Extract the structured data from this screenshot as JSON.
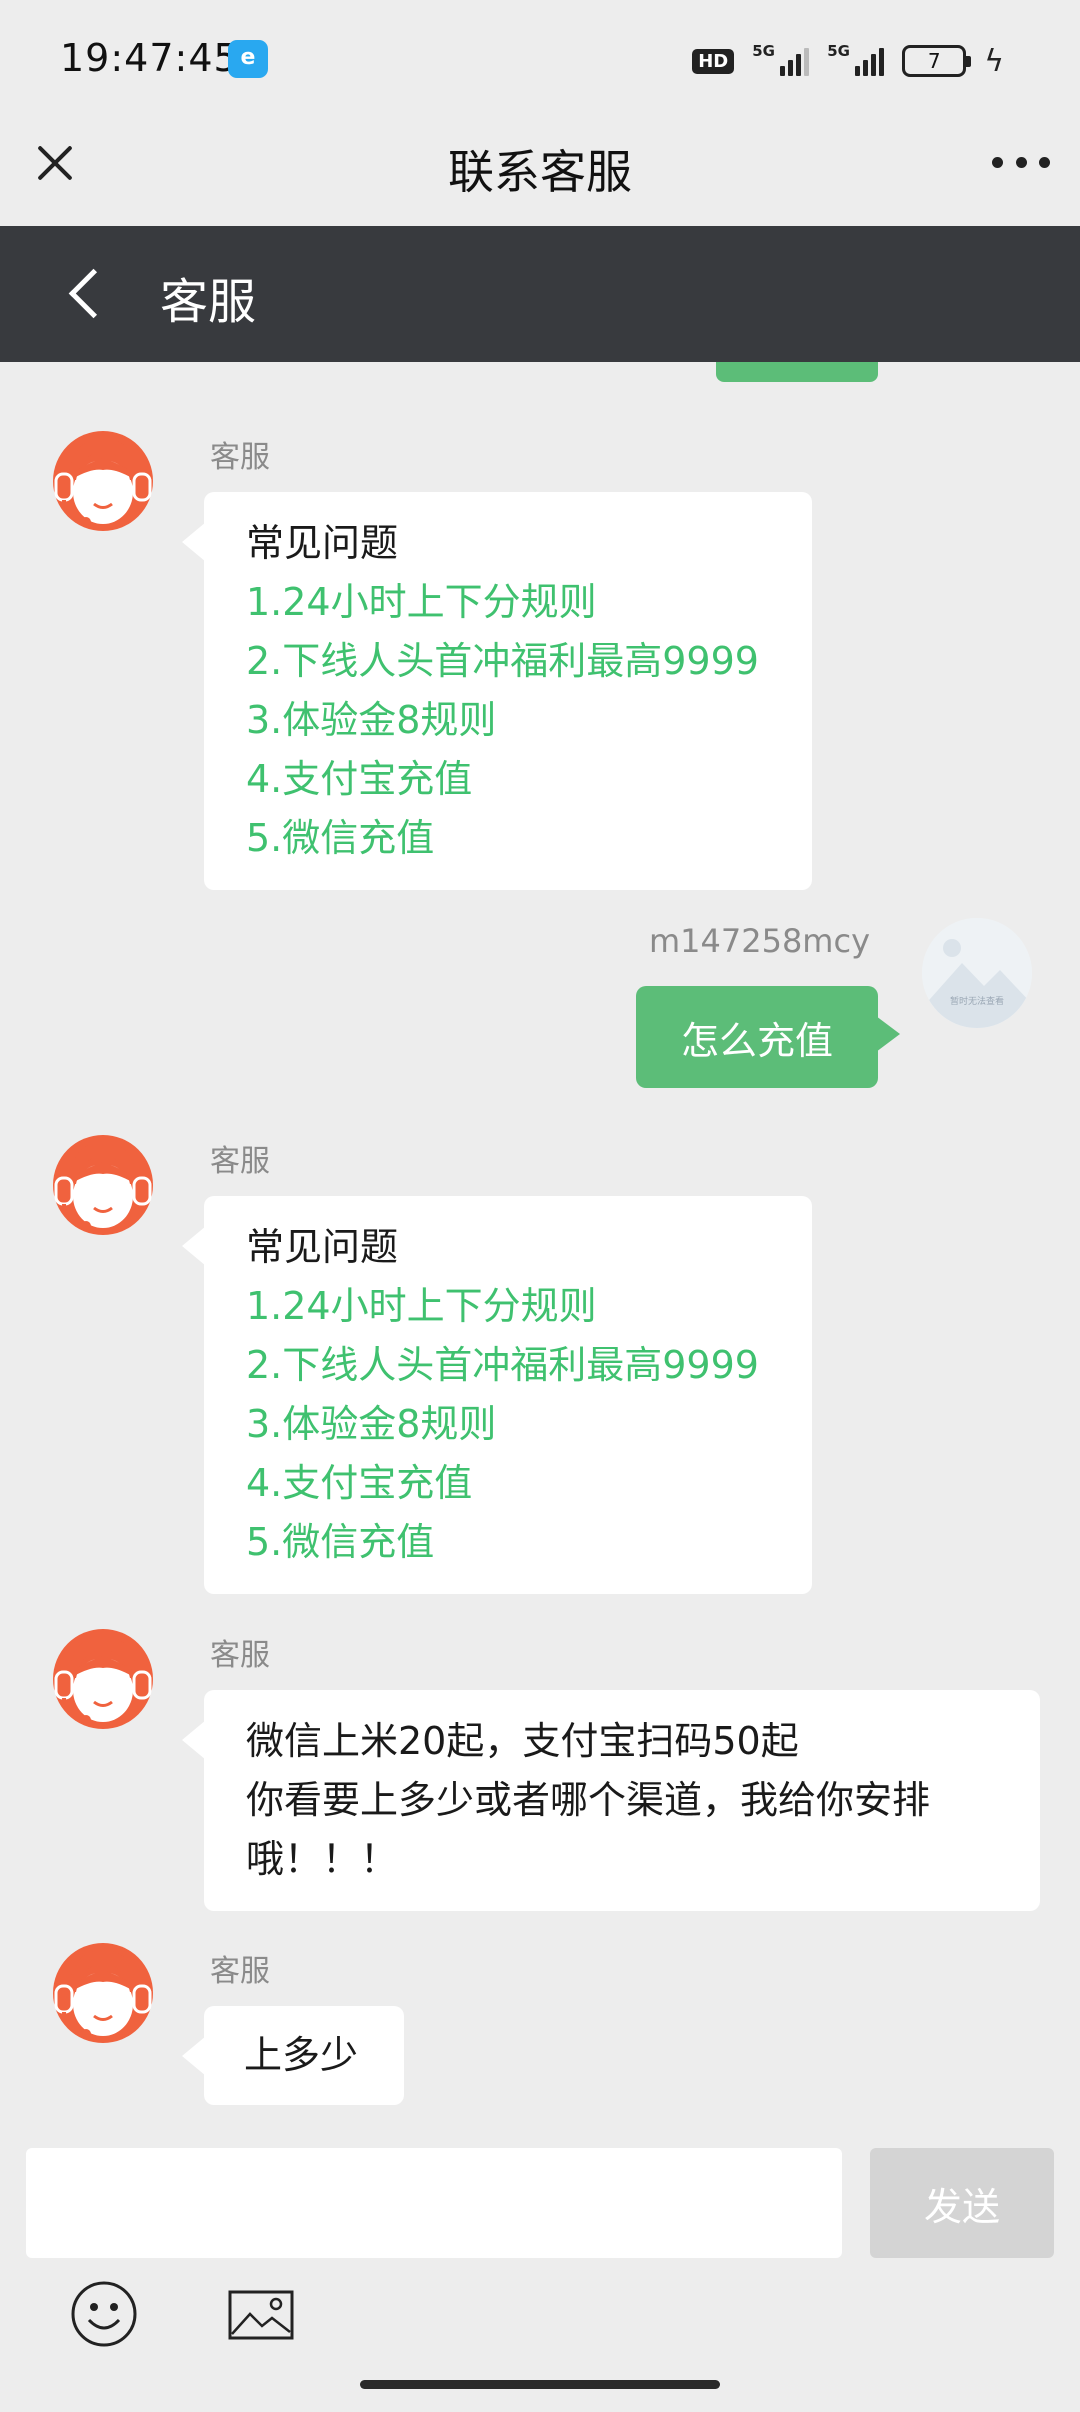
{
  "status_bar": {
    "time": "19:47:45",
    "app_badge": "e",
    "hd_label": "HD",
    "network_1": "5G",
    "network_2": "5G",
    "battery_level": "7"
  },
  "title_bar": {
    "title": "联系客服"
  },
  "chat_header": {
    "title": "客服"
  },
  "messages": [
    {
      "sender": "客服",
      "heading": "常见问题",
      "options": [
        "1.24小时上下分规则",
        "2.下线人头首冲福利最高9999",
        "3.体验金8规则",
        "4.支付宝充值",
        "5.微信充值"
      ]
    },
    {
      "sender": "m147258mcy",
      "text": "怎么充值"
    },
    {
      "sender": "客服",
      "heading": "常见问题",
      "options": [
        "1.24小时上下分规则",
        "2.下线人头首冲福利最高9999",
        "3.体验金8规则",
        "4.支付宝充值",
        "5.微信充值"
      ]
    },
    {
      "sender": "客服",
      "lines": [
        "微信上米20起，支付宝扫码50起",
        "你看要上多少或者哪个渠道，我给你安排",
        "哦！！！"
      ]
    },
    {
      "sender": "客服",
      "text": "上多少"
    }
  ],
  "my_avatar_caption": "暂时无法查看",
  "input_bar": {
    "input_value": "",
    "send_label": "发送"
  },
  "colors": {
    "accent_green": "#3fc16f",
    "my_bubble": "#5cbd78",
    "header_dark": "#383a3e",
    "cs_orange": "#f0623e"
  }
}
